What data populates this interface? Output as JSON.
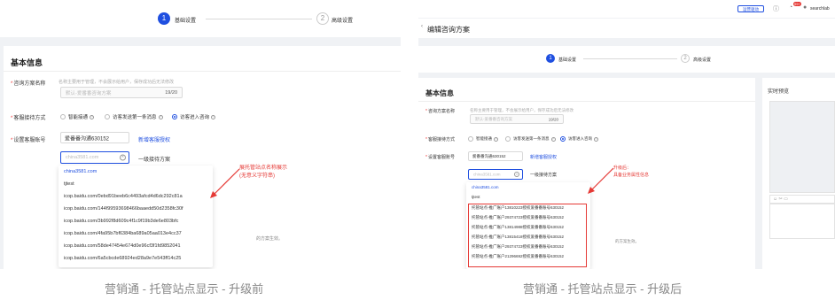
{
  "colors": {
    "accent": "#1f4fe0",
    "annotation": "#e53935",
    "background": "#f0f2f5"
  },
  "left": {
    "steps": [
      {
        "num": "1",
        "label": "基础设置"
      },
      {
        "num": "2",
        "label": "高级设置"
      }
    ],
    "section_title": "基本信息",
    "plan_name": {
      "label": "咨询方案名称",
      "hint": "名称主要用于管理，不会展示给用户，保存成功后无法修改",
      "placeholder": "默认-爱番番咨询方案",
      "count": "19/20"
    },
    "reception": {
      "label": "客服接待方式",
      "options": [
        "智能接通",
        "访客发送第一条消息",
        "访客进入咨询"
      ],
      "selected": 2
    },
    "account": {
      "label": "设置客服账号",
      "select_value": "爱番番沟通630152",
      "link": "新增客服授权",
      "search_placeholder": "china3581.com",
      "plan_text": "一级接待方案"
    },
    "dropdown_items": [
      "china3581.com",
      "tjtest",
      "icop.baidu.com/0ebd91beeb6c4493afcd4d6dc292c81a",
      "icop.baidu.com/144f99593698466baaedd50d2358fc30f",
      "icop.baidu.com/3b992f8d609c4f1c9f19b3de6e803bfc",
      "icop.baidu.com/4fa95b7bf6384ba689a05aa013e4cc37",
      "icop.baidu.com/58de47454e674d0e96cf3f1fd9852041",
      "icop.baidu.com/6a5cbcde68924ed28a9e7e543ff14c25"
    ],
    "hidden_hint": "的方案生效。",
    "annotation": [
      "展托管站点名称展示",
      "(无意义字符串)"
    ],
    "caption": "营销通 - 托管站点显示 - 升级前"
  },
  "right": {
    "topbar": {
      "button": "运营驱动",
      "badge": "99+",
      "user": "searchlab"
    },
    "page_title": "编辑咨询方案",
    "steps": [
      {
        "num": "1",
        "label": "基础设置"
      },
      {
        "num": "2",
        "label": "高级设置"
      }
    ],
    "section_title": "基本信息",
    "plan_name": {
      "label": "咨询方案名称",
      "hint": "名称主要用于管理，不会展示给用户，保存成功后无法修改",
      "placeholder": "默认-爱番番咨询方案",
      "count": "19/20"
    },
    "reception": {
      "label": "客服接待方式",
      "options": [
        "智能接通",
        "访客发送第一条消息",
        "访客进入咨询"
      ],
      "selected": 2
    },
    "account": {
      "label": "设置客服账号",
      "select_value": "爱番番沟通630152",
      "link": "新增客服授权",
      "search_placeholder": "china3581.com",
      "plan_text": "一级接待方案"
    },
    "dropdown_items": [
      "china3581.com",
      "tjtest",
      "托管站点-推广账户13810223授权爱番番账号630152",
      "托管站点-推广账户29374723授权爱番番账号630152",
      "托管站点-推广账户13814988授权爱番番账号630152",
      "托管站点-推广账户13815418授权爱番番账号630152",
      "托管站点-推广账户29374723授权爱番番账号630152",
      "托管站点-推广账户21296692授权爱番番账号630152"
    ],
    "hidden_hint": "的方案生效。",
    "annotation": [
      "升级后：",
      "具备业务属性信息"
    ],
    "preview_title": "实时预览",
    "caption": "营销通 - 托管站点显示 - 升级后"
  }
}
